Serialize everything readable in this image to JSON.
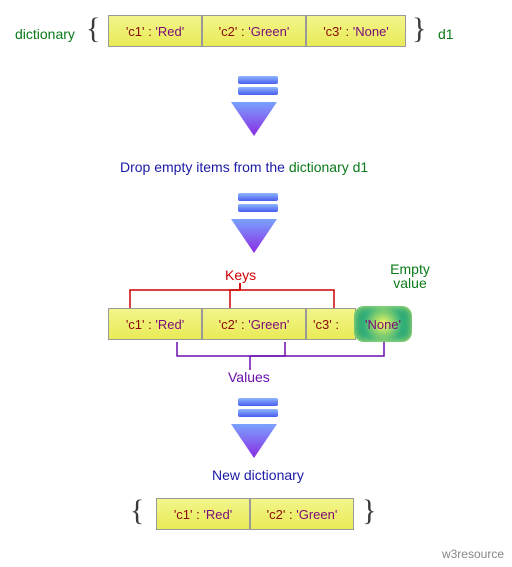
{
  "labels": {
    "dictionary": "dictionary",
    "d1": "d1",
    "drop_text_prefix": "Drop empty items from the ",
    "drop_text_suffix": "dictionary d1",
    "keys": "Keys",
    "values": "Values",
    "empty_value": "Empty\nvalue",
    "new_dictionary": "New dictionary",
    "footer": "w3resource"
  },
  "dict1": [
    {
      "key": "'c1'",
      "val": "'Red'"
    },
    {
      "key": "'c2'",
      "val": "'Green'"
    },
    {
      "key": "'c3'",
      "val": "'None'"
    }
  ],
  "dict2": [
    {
      "key": "'c1'",
      "val": "'Red'"
    },
    {
      "key": "'c2'",
      "val": "'Green'"
    },
    {
      "key": "'c3'",
      "val": "'None'",
      "empty": true
    }
  ],
  "dict3": [
    {
      "key": "'c1'",
      "val": "'Red'"
    },
    {
      "key": "'c2'",
      "val": "'Green'"
    }
  ],
  "colors": {
    "green": "#0a7a1a",
    "blue": "#1a1aa6",
    "red": "#d00000",
    "purple": "#6a0dad"
  }
}
